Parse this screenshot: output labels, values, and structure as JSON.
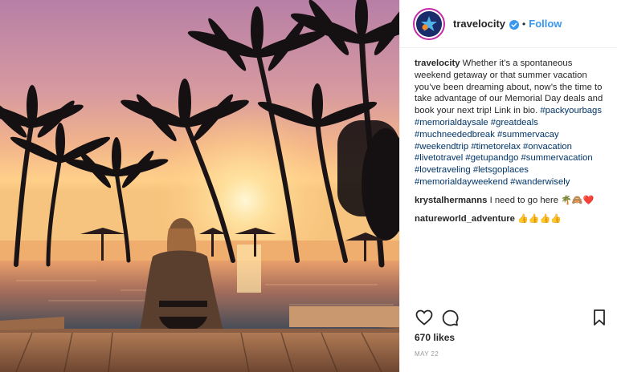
{
  "post": {
    "image_alt_icon": "beach-sunset-photo",
    "header": {
      "username": "travelocity",
      "separator": "•",
      "follow_label": "Follow",
      "verified_icon": "verified-badge-icon"
    },
    "caption": {
      "username": "travelocity",
      "text": "Whether it’s a spontaneous weekend getaway or that summer vacation you’ve been dreaming about, now’s the time to take advantage of our Memorial Day deals and book your next trip! Link in bio.",
      "hashtags": "#packyourbags #memorialdaysale #greatdeals #muchneededbreak #summervacay #weekendtrip #timetorelax #onvacation #livetotravel #getupandgo #summervacation #lovetraveling #letsgoplaces #memorialdayweekend #wanderwisely"
    },
    "comments": [
      {
        "username": "krystalhermanns",
        "text": "I need to go here",
        "emoji": "🌴🙈❤️"
      },
      {
        "username": "natureworld_adventure",
        "text": "",
        "emoji": "👍👍👍👍"
      }
    ],
    "actions": {
      "like_icon": "heart-icon",
      "comment_icon": "comment-icon",
      "save_icon": "bookmark-icon"
    },
    "likes_text": "670 likes",
    "date": "MAY 22"
  },
  "colors": {
    "link": "#3897f0",
    "hashtag": "#003569",
    "text": "#262626",
    "muted": "#999999"
  }
}
